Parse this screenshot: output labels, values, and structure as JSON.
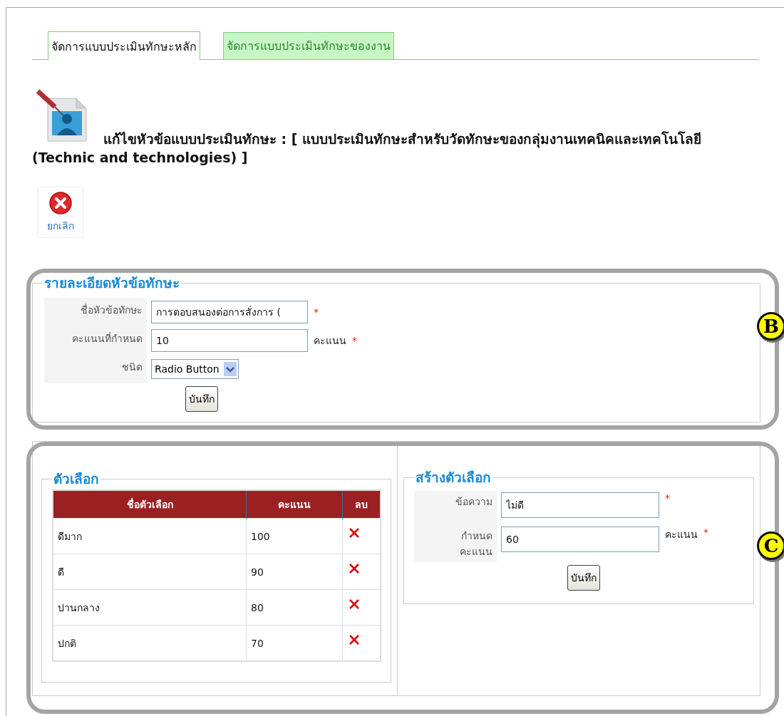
{
  "tabs": [
    {
      "label": "จัดการแบบประเมินทักษะหลัก",
      "selected": true
    },
    {
      "label": "จัดการแบบประเมินทักษะของงาน",
      "selected": false
    }
  ],
  "heading": "แก้ไขหัวข้อแบบประเมินทักษะ : [ แบบประเมินทักษะสำหรับวัดทักษะของกลุ่มงานเทคนิคและเทคโนโลยี (Technic and technologies) ]",
  "cancel_button": "ยกเลิก",
  "skill_details": {
    "legend": "รายละเอียดหัวข้อทักษะ",
    "fields": [
      {
        "label": "ชื่อหัวข้อทักษะ",
        "kind": "text",
        "value": "การตอบสนองต่อการสั่งการ (",
        "mark": "*"
      },
      {
        "label": "คะแนนที่กำหนด",
        "kind": "text",
        "value": "10",
        "unit": "คะแนน",
        "mark": "*"
      },
      {
        "label": "ชนิด",
        "kind": "select",
        "value": "Radio Button"
      }
    ],
    "save_button": "บันทึก"
  },
  "options": {
    "legend": "ตัวเลือก",
    "columns": [
      "ชื่อตัวเลือก",
      "คะแนน",
      "ลบ"
    ],
    "rows": [
      {
        "name": "ดีมาก",
        "score": "100"
      },
      {
        "name": "ดี",
        "score": "90"
      },
      {
        "name": "ปานกลาง",
        "score": "80"
      },
      {
        "name": "ปกติ",
        "score": "70"
      }
    ]
  },
  "create_option": {
    "legend": "สร้างตัวเลือก",
    "fields": [
      {
        "label": "ข้อความ",
        "kind": "text",
        "value": "ไม่ดี",
        "mark": "*"
      },
      {
        "label": "กำหนด คะแนน",
        "kind": "text",
        "value": "60",
        "unit": "คะแนน",
        "mark": "*"
      }
    ],
    "save_button": "บันทึก"
  },
  "callouts": [
    {
      "label": "B"
    },
    {
      "label": "C"
    }
  ]
}
